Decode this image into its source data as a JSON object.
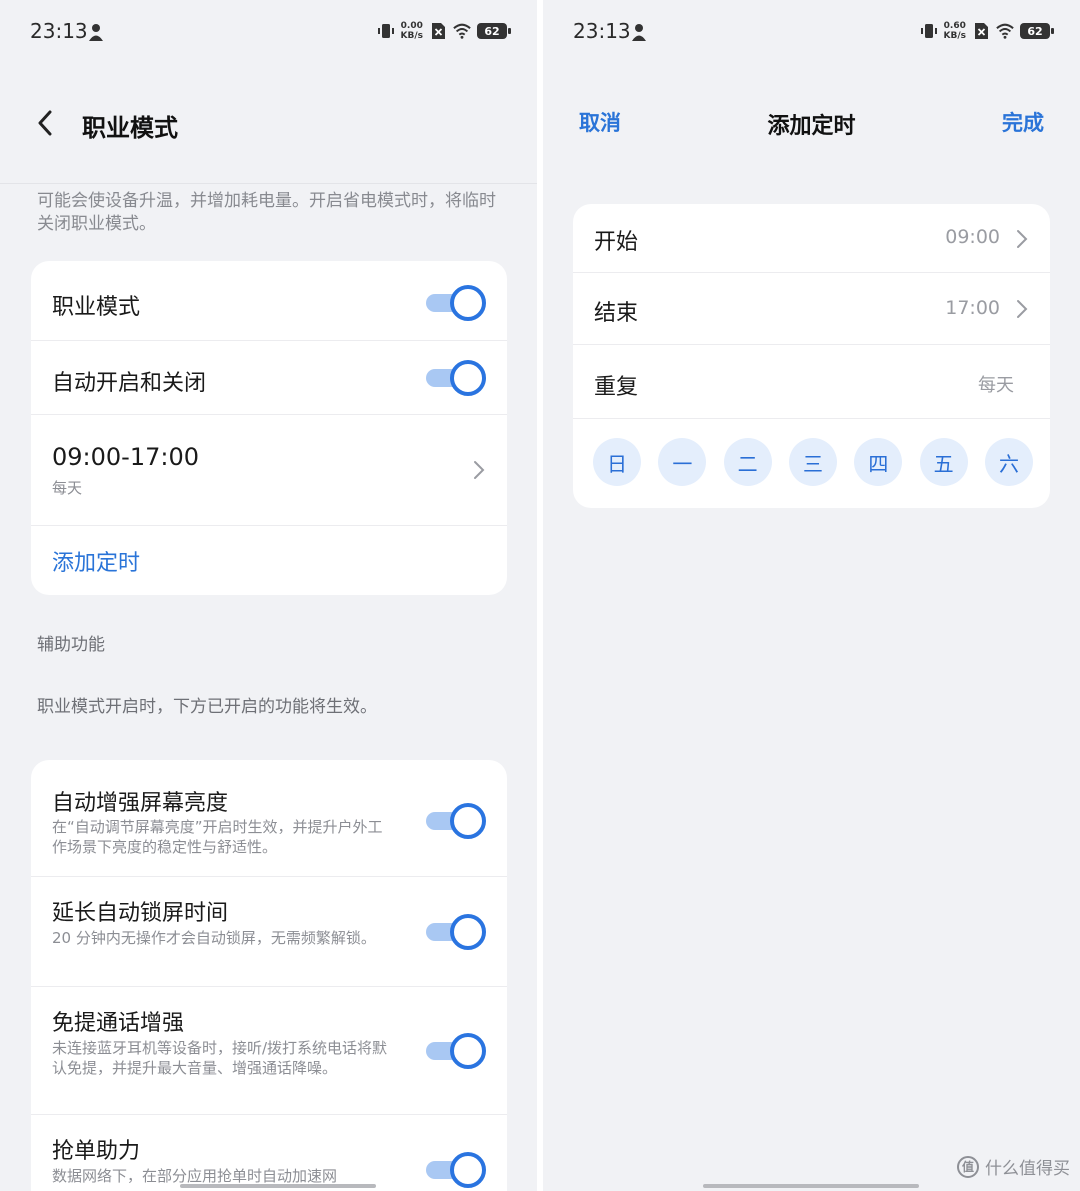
{
  "status_bar": {
    "time": "23:13",
    "left_speed": [
      "0.00",
      "KB/s"
    ],
    "right_speed": [
      "0.60",
      "KB/s"
    ],
    "battery": "62",
    "icons": [
      "person-icon",
      "vibrate-icon",
      "sim-off-icon",
      "wifi-icon",
      "battery-icon"
    ]
  },
  "left": {
    "title": "职业模式",
    "intro": "可能会使设备升温，并增加耗电量。开启省电模式时，将临时关闭职业模式。",
    "main_card": {
      "mode_label": "职业模式",
      "mode_on": true,
      "auto_label": "自动开启和关闭",
      "auto_on": true,
      "schedule_time": "09:00-17:00",
      "schedule_repeat": "每天",
      "add_schedule": "添加定时"
    },
    "aux_section": "辅助功能",
    "aux_note": "职业模式开启时，下方已开启的功能将生效。",
    "features": [
      {
        "title": "自动增强屏幕亮度",
        "desc": "在“自动调节屏幕亮度”开启时生效，并提升户外工作场景下亮度的稳定性与舒适性。",
        "on": true
      },
      {
        "title": "延长自动锁屏时间",
        "desc": "20 分钟内无操作才会自动锁屏，无需频繁解锁。",
        "on": true
      },
      {
        "title": "免提通话增强",
        "desc": "未连接蓝牙耳机等设备时，接听/拨打系统电话将默认免提，并提升最大音量、增强通话降噪。",
        "on": true
      },
      {
        "title": "抢单助力",
        "desc": "数据网络下，在部分应用抢单时自动加速网",
        "on": true
      }
    ]
  },
  "right": {
    "cancel": "取消",
    "title": "添加定时",
    "done": "完成",
    "start_label": "开始",
    "start_value": "09:00",
    "end_label": "结束",
    "end_value": "17:00",
    "repeat_label": "重复",
    "repeat_value": "每天",
    "days": [
      "日",
      "一",
      "二",
      "三",
      "四",
      "五",
      "六"
    ]
  },
  "watermark": {
    "icon_text": "值",
    "text": "什么值得买"
  },
  "colors": {
    "accent": "#2a74d8",
    "background": "#f1f2f5",
    "card": "#ffffff",
    "toggle_track": "#a9c8f3",
    "day_chip": "#e4eefc"
  }
}
